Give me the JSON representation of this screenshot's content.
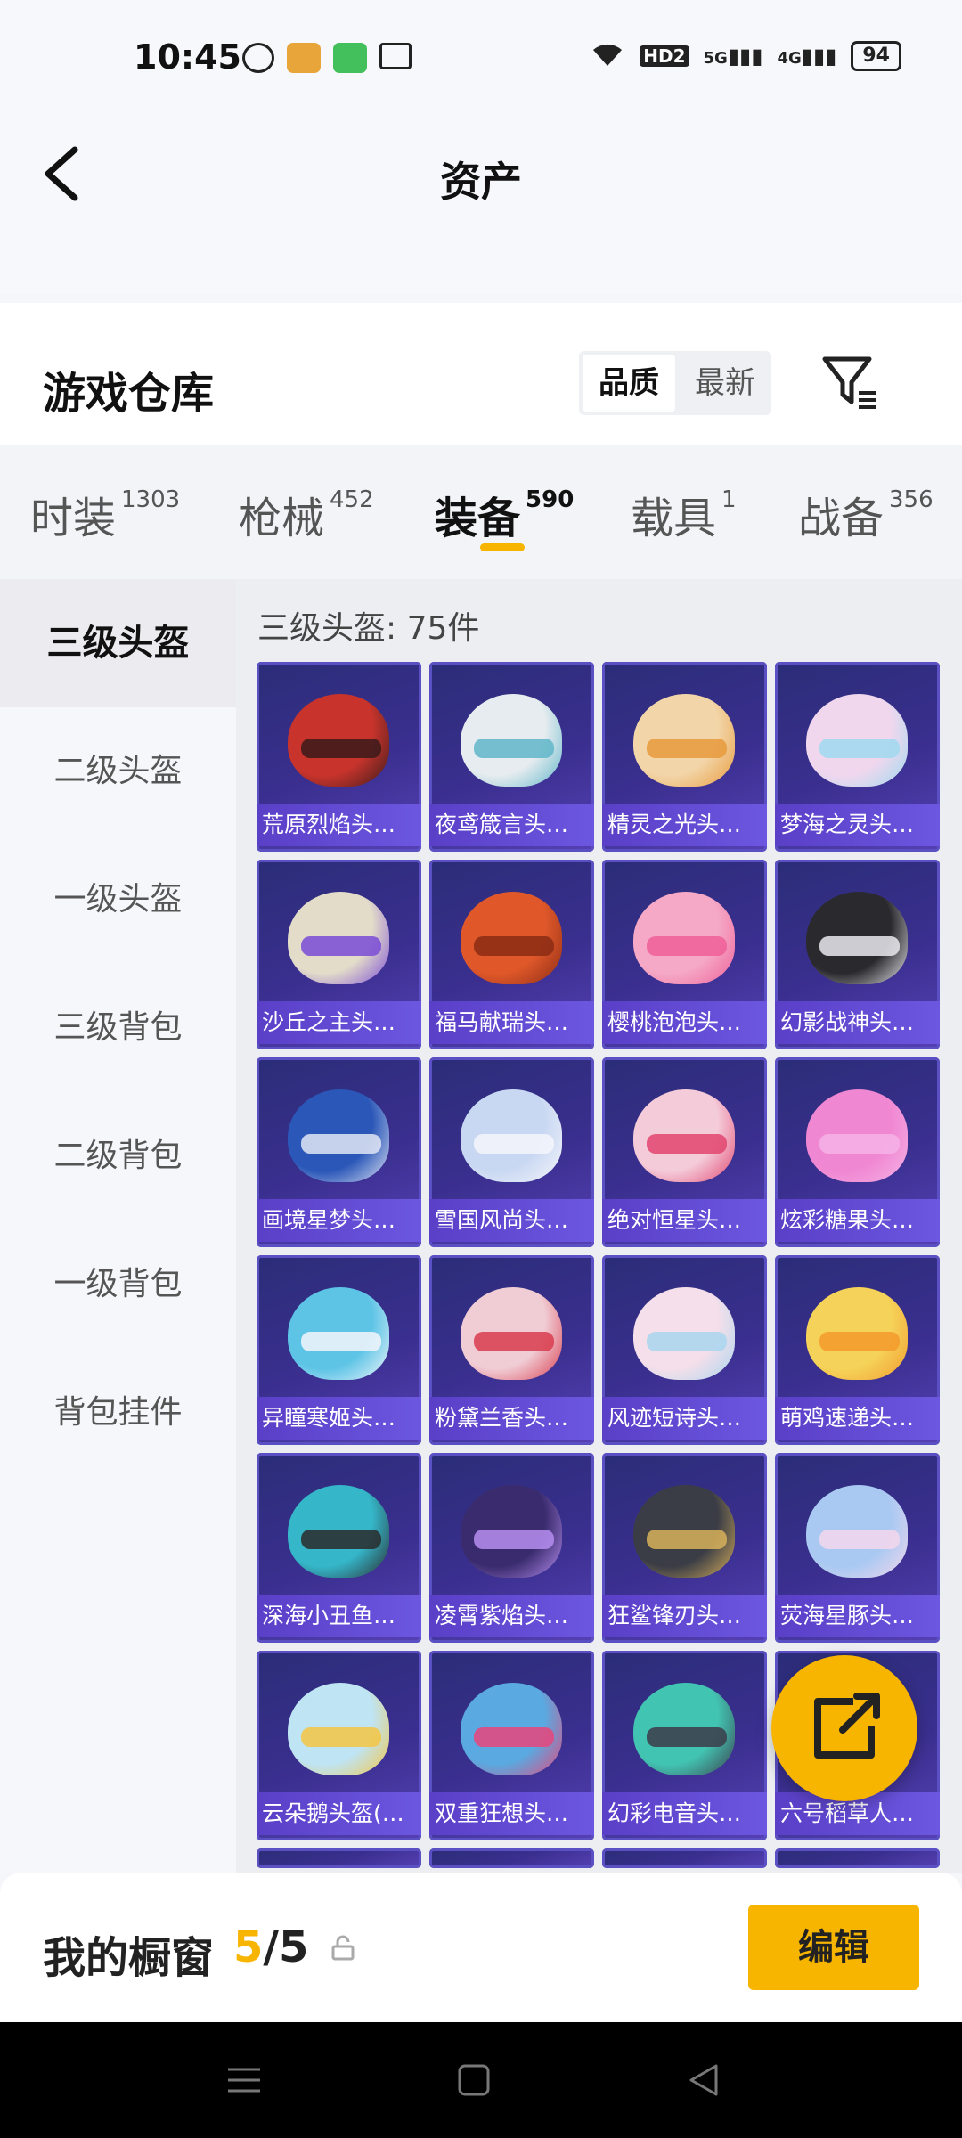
{
  "status_bar": {
    "time": "10:45",
    "battery": "94",
    "network_1": "5G",
    "network_2": "4G",
    "hd": "HD2"
  },
  "header": {
    "title": "资产"
  },
  "warehouse": {
    "title": "游戏仓库",
    "sort_options": [
      "品质",
      "最新"
    ],
    "active_sort": "品质"
  },
  "category_tabs": [
    {
      "label": "时装",
      "count": "1303"
    },
    {
      "label": "枪械",
      "count": "452"
    },
    {
      "label": "装备",
      "count": "590"
    },
    {
      "label": "载具",
      "count": "1"
    },
    {
      "label": "战备",
      "count": "356"
    }
  ],
  "active_tab": "装备",
  "sidebar": {
    "items": [
      "三级头盔",
      "二级头盔",
      "一级头盔",
      "三级背包",
      "二级背包",
      "一级背包",
      "背包挂件"
    ],
    "active": "三级头盔"
  },
  "content": {
    "title": "三级头盔: 75件",
    "items": [
      {
        "name": "荒原烈焰头盔...",
        "colors": [
          "#c8342c",
          "#3a1a1a"
        ]
      },
      {
        "name": "夜鸢箴言头盔...",
        "colors": [
          "#e6ecef",
          "#5fb6c9"
        ]
      },
      {
        "name": "精灵之光头盔...",
        "colors": [
          "#f2d5a8",
          "#e89a3c"
        ]
      },
      {
        "name": "梦海之灵头盔...",
        "colors": [
          "#f0d7ee",
          "#9fd9ee"
        ]
      },
      {
        "name": "沙丘之主头盔...",
        "colors": [
          "#e3dcc9",
          "#7a4bd6"
        ]
      },
      {
        "name": "福马献瑞头盔...",
        "colors": [
          "#e0582a",
          "#8a2c14"
        ]
      },
      {
        "name": "樱桃泡泡头盔...",
        "colors": [
          "#f5a9c6",
          "#ef5f99"
        ]
      },
      {
        "name": "幻影战神头盔...",
        "colors": [
          "#2a2a2e",
          "#e9e9ef"
        ]
      },
      {
        "name": "画境星梦头盔...",
        "colors": [
          "#2a57b8",
          "#e2e6f4"
        ]
      },
      {
        "name": "雪国风尚头盔...",
        "colors": [
          "#c9d8f2",
          "#f6f6fb"
        ]
      },
      {
        "name": "绝对恒星头盔...",
        "colors": [
          "#f4cbd9",
          "#e2456f"
        ]
      },
      {
        "name": "炫彩糖果头盔...",
        "colors": [
          "#f087d2",
          "#f6b3e7"
        ]
      },
      {
        "name": "异瞳寒姬头盔...",
        "colors": [
          "#5ec4e6",
          "#f3f6fb"
        ]
      },
      {
        "name": "粉黛兰香头盔...",
        "colors": [
          "#f0ccd4",
          "#d83c4e"
        ]
      },
      {
        "name": "风迹短诗头盔...",
        "colors": [
          "#f5dfea",
          "#a9d6ef"
        ]
      },
      {
        "name": "萌鸡速递头盔...",
        "colors": [
          "#f5d35a",
          "#f39a2d"
        ]
      },
      {
        "name": "深海小丑鱼头...",
        "colors": [
          "#35b6c9",
          "#2a2a2a"
        ]
      },
      {
        "name": "凌霄紫焰头盔...",
        "colors": [
          "#3a2b6e",
          "#b78ef0"
        ]
      },
      {
        "name": "狂鲨锋刃头盔...",
        "colors": [
          "#3b3d46",
          "#d8b15b"
        ]
      },
      {
        "name": "荧海星豚头盔...",
        "colors": [
          "#a9c9f2",
          "#f4d7ec"
        ]
      },
      {
        "name": "云朵鹅头盔(3...",
        "colors": [
          "#bfe4f4",
          "#f5c543"
        ]
      },
      {
        "name": "双重狂想头盔...",
        "colors": [
          "#5aa9e0",
          "#e8457a"
        ]
      },
      {
        "name": "幻彩电音头盔...",
        "colors": [
          "#42c4b2",
          "#3c3c4a"
        ]
      },
      {
        "name": "六号稻草人头...",
        "colors": [
          "#5a5fd6",
          "#f2c24a"
        ]
      }
    ]
  },
  "showcase": {
    "label": "我的橱窗",
    "count_current": "5",
    "separator": "/",
    "count_total": "5",
    "edit_label": "编辑"
  },
  "colors": {
    "accent": "#f7b500",
    "card_bg": "#3a2f8f",
    "card_label": "#6c57e0"
  }
}
